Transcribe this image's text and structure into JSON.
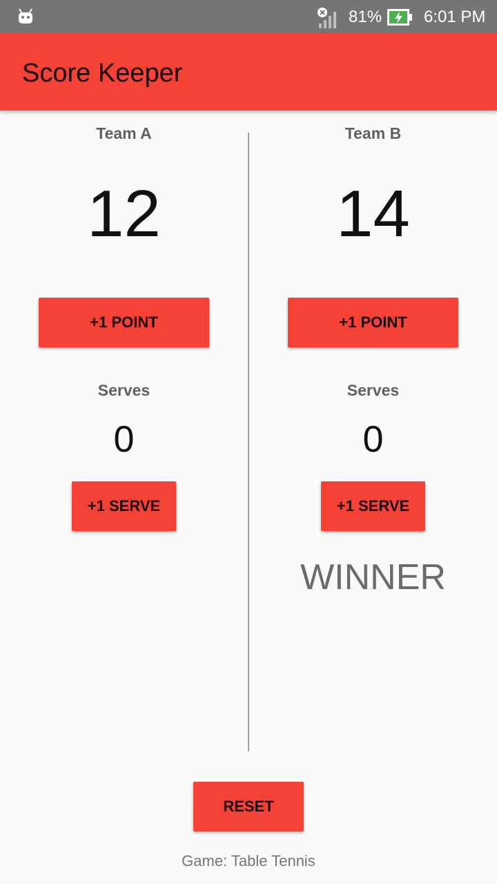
{
  "status_bar": {
    "battery_percent": "81%",
    "time": "6:01 PM",
    "icons": [
      "android-icon",
      "signal-off-icon",
      "battery-charging-icon"
    ]
  },
  "app_bar": {
    "title": "Score Keeper",
    "color": "#f44336"
  },
  "team_a": {
    "name": "Team A",
    "score": "12",
    "point_button": "+1 POINT",
    "serves_label": "Serves",
    "serves": "0",
    "serve_button": "+1 SERVE"
  },
  "team_b": {
    "name": "Team B",
    "score": "14",
    "point_button": "+1 POINT",
    "serves_label": "Serves",
    "serves": "0",
    "serve_button": "+1 SERVE",
    "status": "WINNER"
  },
  "reset_button": "RESET",
  "game_label": "Game: Table Tennis"
}
